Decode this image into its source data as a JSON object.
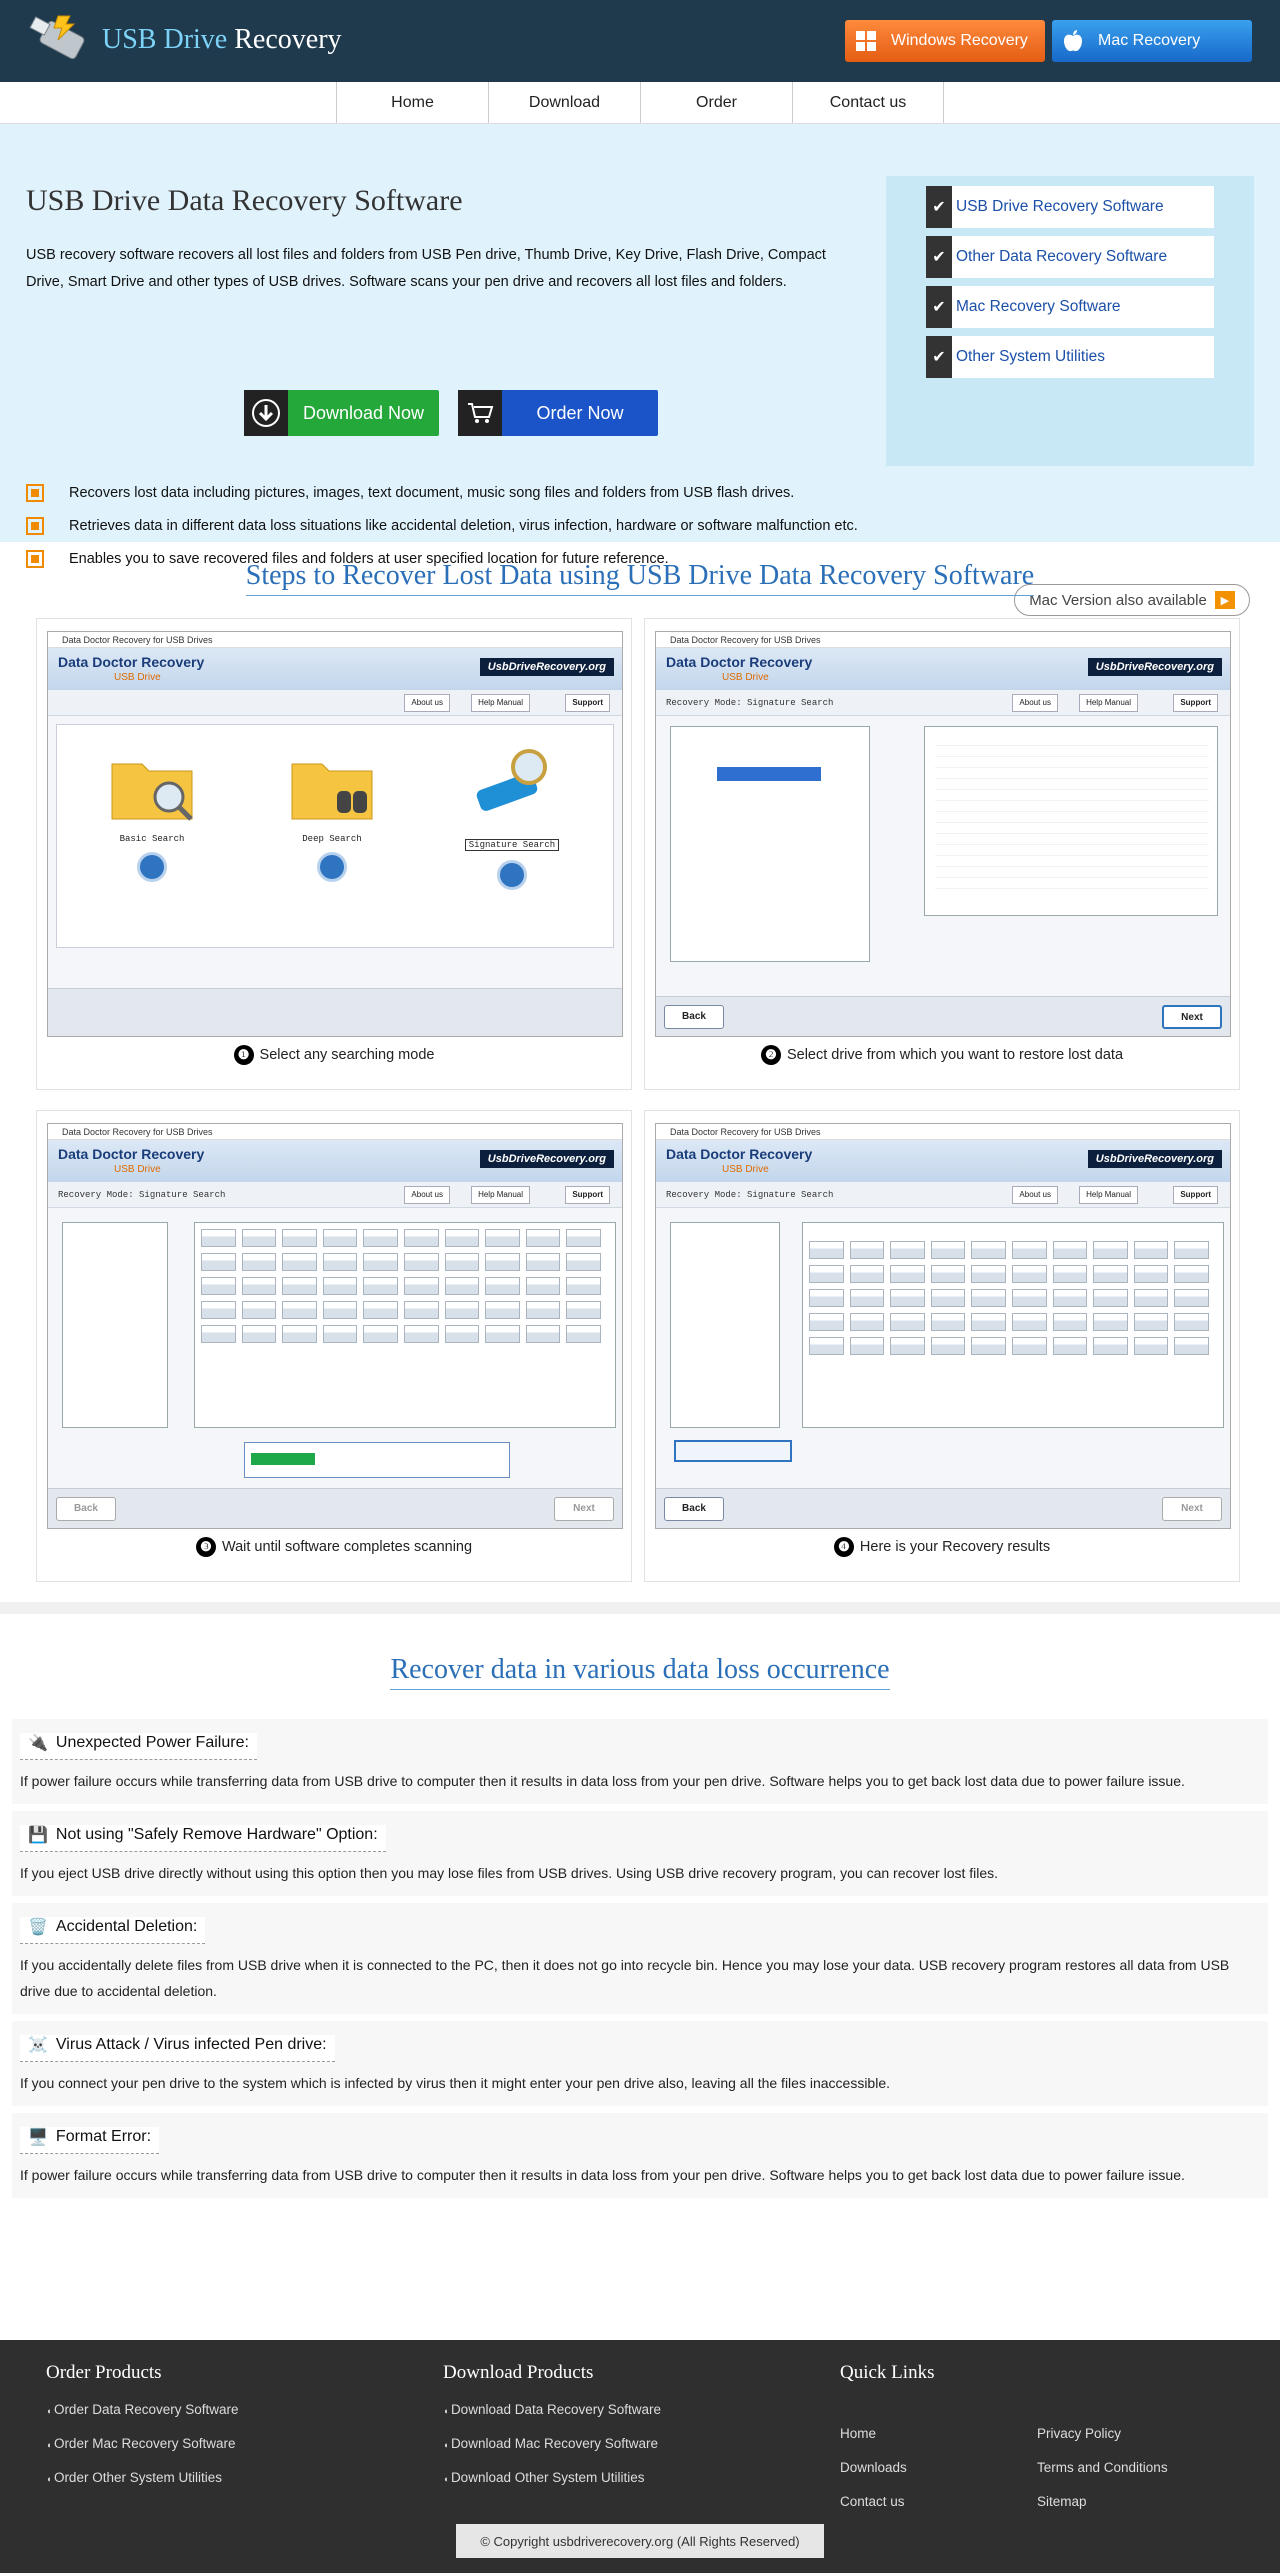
{
  "header": {
    "logo_usb": "USB Drive",
    "logo_rest": " Recovery",
    "windows_btn": "Windows Recovery",
    "mac_btn": "Mac Recovery"
  },
  "nav": [
    "Home",
    "Download",
    "Order",
    "Contact us"
  ],
  "hero": {
    "title": "USB Drive Data Recovery Software",
    "intro": "USB recovery software recovers all lost files and folders from USB Pen drive, Thumb Drive, Key Drive, Flash Drive, Compact Drive, Smart Drive and other types of USB drives. Software scans your pen drive and recovers all lost files and folders.",
    "download_btn": "Download Now",
    "order_btn": "Order Now",
    "bullets": [
      "Recovers lost data including pictures, images, text document, music song files and folders from USB flash drives.",
      "Retrieves data in different data loss situations like accidental deletion, virus infection, hardware or software malfunction etc.",
      "Enables you to save recovered files and folders at user specified location for future reference."
    ],
    "side_links": [
      "USB Drive Recovery Software",
      "Other Data Recovery Software",
      "Mac Recovery Software",
      "Other System Utilities"
    ],
    "mac_version": "Mac Version also available"
  },
  "steps": {
    "title": "Steps to Recover Lost Data using USB Drive Data Recovery Software",
    "app": {
      "window_title": "Data Doctor Recovery for USB Drives",
      "name": "Data Doctor Recovery",
      "sub": "USB Drive",
      "brand": "UsbDriveRecovery.org",
      "mode": "Recovery Mode: Signature Search",
      "about": "About us",
      "help": "Help Manual",
      "support": "Support",
      "back": "Back",
      "next": "Next"
    },
    "step1_modes": [
      "Basic Search",
      "Deep Search",
      "Signature Search"
    ],
    "items": [
      {
        "num": "❶",
        "caption": "Select any searching mode"
      },
      {
        "num": "❷",
        "caption": "Select drive from which you want to restore lost data"
      },
      {
        "num": "❸",
        "caption": "Wait until software completes scanning"
      },
      {
        "num": "❹",
        "caption": "Here is your Recovery results"
      }
    ]
  },
  "occurrence": {
    "title": "Recover data in various data loss occurrence",
    "cases": [
      {
        "icon": "🔌",
        "title": "Unexpected Power Failure:",
        "text": "If power failure occurs while transferring data from USB drive to computer then it results in data loss from your pen drive. Software helps you to get back lost data due to power failure issue."
      },
      {
        "icon": "💾",
        "title": "Not using \"Safely Remove Hardware\" Option:",
        "text": "If you eject USB drive directly without using this option then you may lose files from USB drives. Using USB drive recovery program, you can recover lost files."
      },
      {
        "icon": "🗑️",
        "title": "Accidental Deletion:",
        "text": "If you accidentally delete files from USB drive when it is connected to the PC, then it does not go into recycle bin. Hence you may lose your data. USB recovery program restores all data from USB drive due to accidental deletion."
      },
      {
        "icon": "☠️",
        "title": "Virus Attack / Virus infected Pen drive:",
        "text": "If you connect your pen drive to the system which is infected by virus then it might enter your pen drive also, leaving all the files inaccessible."
      },
      {
        "icon": "🖥️",
        "title": "Format Error:",
        "text": "If power failure occurs while transferring data from USB drive to computer then it results in data loss from your pen drive. Software helps you to get back lost data due to power failure issue."
      }
    ]
  },
  "footer": {
    "order_title": "Order Products",
    "order_items": [
      "Order Data Recovery Software",
      "Order Mac Recovery Software",
      "Order Other System Utilities"
    ],
    "download_title": "Download Products",
    "download_items": [
      "Download Data Recovery Software",
      "Download Mac Recovery Software",
      "Download Other System Utilities"
    ],
    "quick_title": "Quick Links",
    "quick_left": [
      "Home",
      "Downloads",
      "Contact us"
    ],
    "quick_right": [
      "Privacy Policy",
      "Terms and Conditions",
      "Sitemap"
    ],
    "copyright": "© Copyright usbdriverecovery.org (All Rights Reserved)"
  },
  "colors": {
    "header_bg": "#1f3a4d",
    "hero_bg": "#e0f3fc",
    "title_blue": "#2a6fb7",
    "footer_bg": "#2f2f2f"
  }
}
